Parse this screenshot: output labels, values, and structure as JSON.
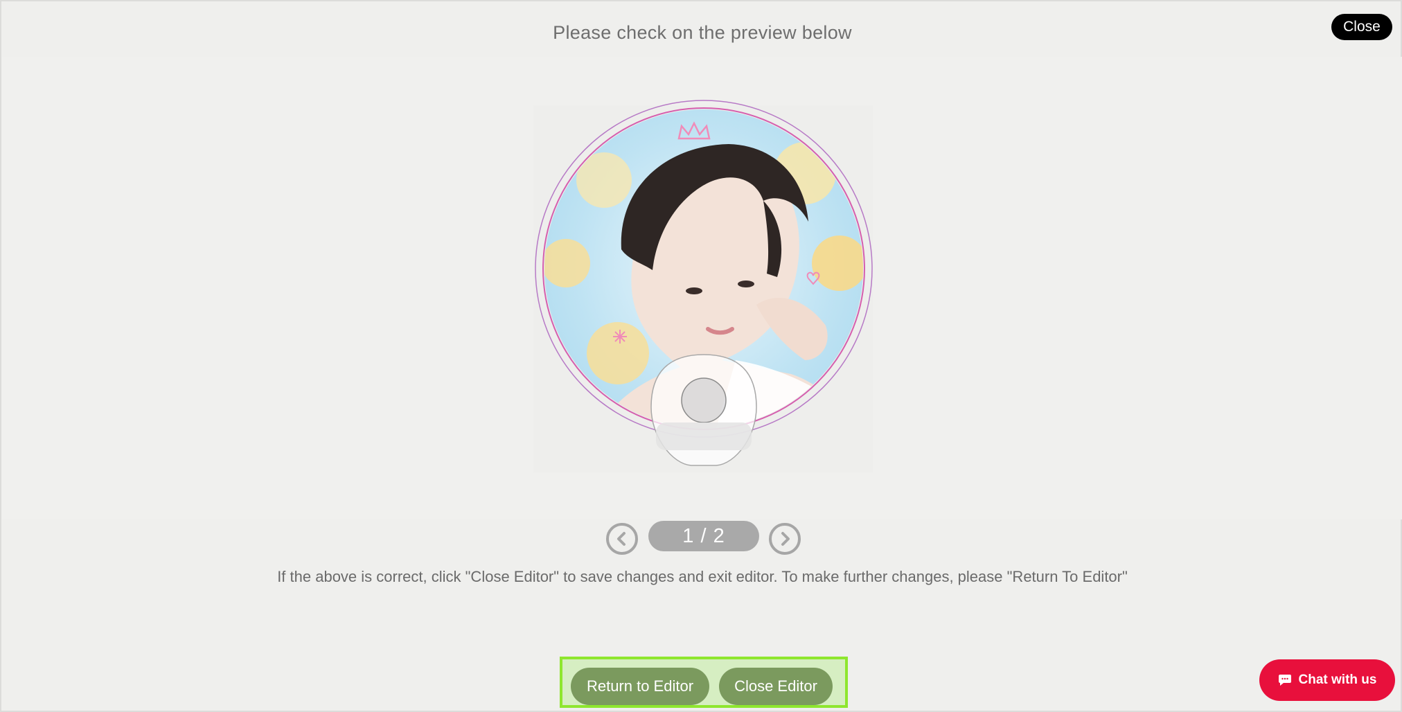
{
  "header": {
    "title": "Please check on the preview below",
    "close_label": "Close"
  },
  "preview": {
    "image_alt": "Circular fan preview with portrait",
    "accent_color": "#c85aa8"
  },
  "pager": {
    "current": "1 / 2",
    "prev_icon": "chevron-left-icon",
    "next_icon": "chevron-right-icon"
  },
  "instructions": "If the above is correct, click \"Close Editor\" to save changes and exit editor. To make further changes, please \"Return To Editor\"",
  "actions": {
    "return_label": "Return to Editor",
    "close_label": "Close Editor",
    "highlight_color": "#8ee62e",
    "button_color": "#7b9a5e"
  },
  "chat": {
    "label": "Chat with us",
    "icon": "chat-bubble-icon",
    "color": "#e8103c"
  }
}
